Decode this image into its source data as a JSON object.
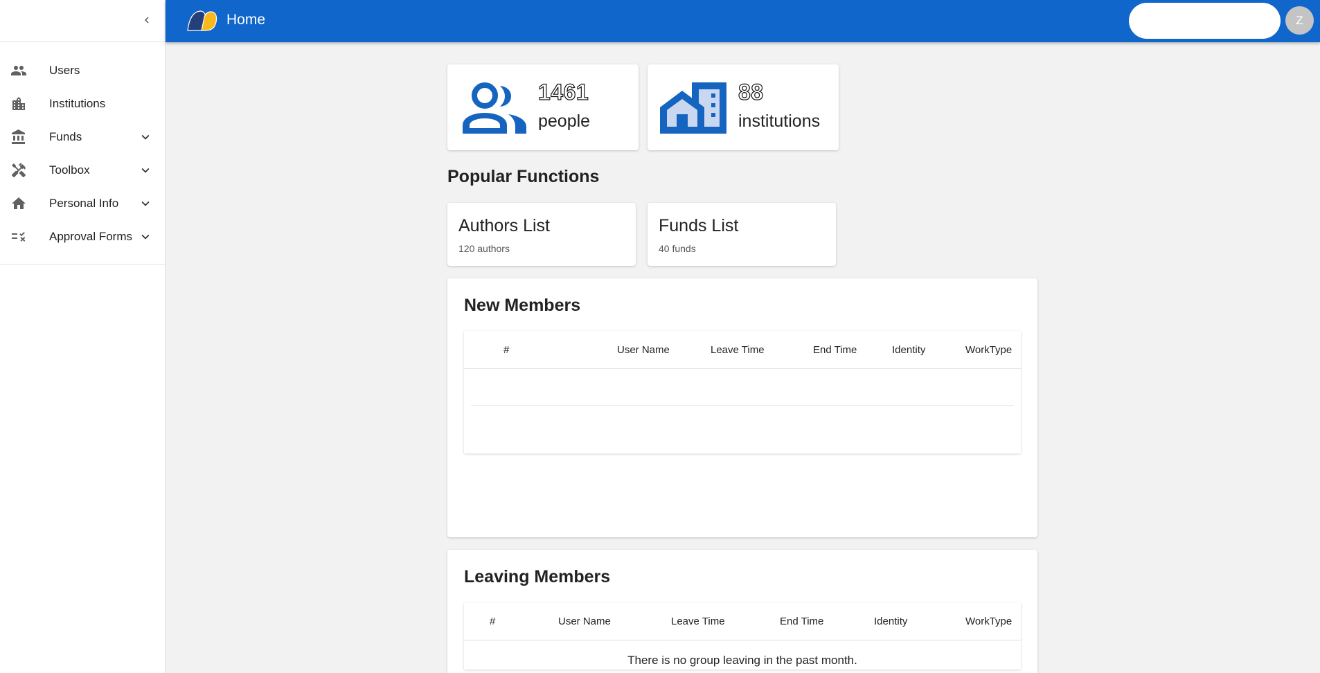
{
  "header": {
    "title": "Home",
    "search_placeholder": "",
    "avatar_initial": "Z"
  },
  "sidebar": {
    "items": [
      {
        "label": "Users",
        "icon": "people-icon",
        "expandable": false
      },
      {
        "label": "Institutions",
        "icon": "building-icon",
        "expandable": false
      },
      {
        "label": "Funds",
        "icon": "bank-icon",
        "expandable": true
      },
      {
        "label": "Toolbox",
        "icon": "tools-icon",
        "expandable": true
      },
      {
        "label": "Personal Info",
        "icon": "home-icon",
        "expandable": true
      },
      {
        "label": "Approval Forms",
        "icon": "checklist-icon",
        "expandable": true
      }
    ]
  },
  "stats": {
    "people": {
      "value": "1461",
      "caption": "people"
    },
    "institutions": {
      "value": "88",
      "caption": "institutions"
    }
  },
  "popular": {
    "title": "Popular Functions",
    "authors": {
      "title": "Authors List",
      "subtitle": "120 authors"
    },
    "funds": {
      "title": "Funds List",
      "subtitle": "40 funds"
    }
  },
  "new_members": {
    "title": "New Members",
    "columns": [
      "#",
      "User Name",
      "Leave Time",
      "End Time",
      "Identity",
      "WorkType"
    ],
    "rows": []
  },
  "leaving_members": {
    "title": "Leaving Members",
    "columns": [
      "#",
      "User Name",
      "Leave Time",
      "End Time",
      "Identity",
      "WorkType"
    ],
    "empty_message": "There is no group leaving in the past month."
  },
  "colors": {
    "appbar": "#1166cc",
    "icon_blue": "#1565c0",
    "logo_yellow": "#f9b81b",
    "logo_navy": "#24407a"
  }
}
